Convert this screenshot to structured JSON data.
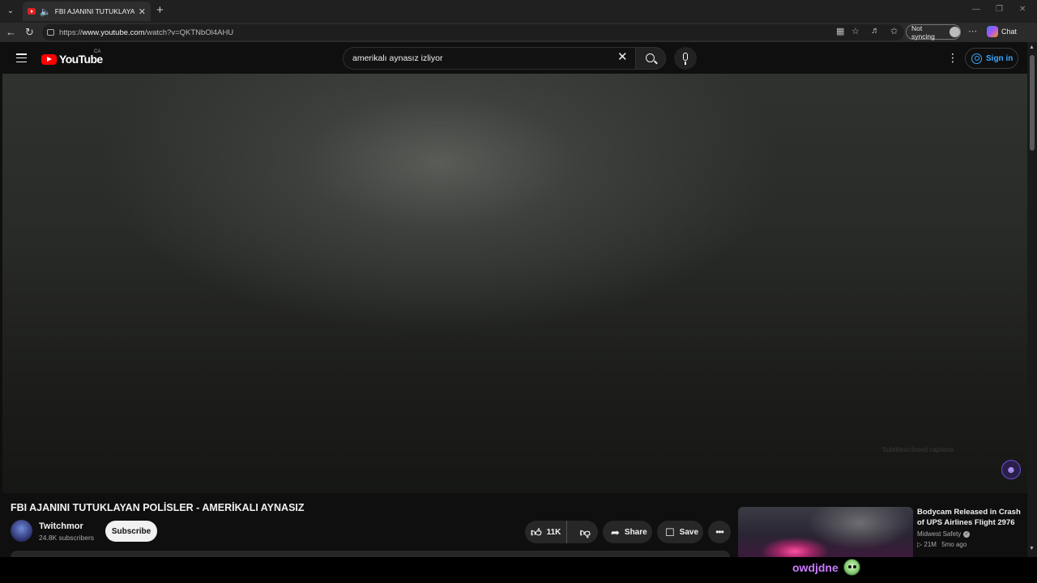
{
  "browser": {
    "tab_title": "FBI AJANINI TUTUKLAYAN POLİSLER - AMERİKALI AYNASIZ",
    "url_prefix": "https://",
    "url_host": "www.youtube.com",
    "url_path": "/watch?v=QKTNbOl4AHU",
    "sync_label": "Not syncing",
    "copilot_label": "Chat",
    "icons": [
      "tab-list-icon",
      "speaker-icon",
      "close-icon",
      "plus-icon",
      "back-icon",
      "reload-icon",
      "lock-icon",
      "app-icon",
      "star-icon",
      "reading-list-icon",
      "favorites-icon",
      "more-icon",
      "copilot-icon"
    ]
  },
  "youtube_header": {
    "logo_text": "YouTube",
    "country_code": "CA",
    "search_query": "amerikalı aynasız izliyor",
    "sign_in_label": "Sign in"
  },
  "player": {
    "captions_hint": "Subtitles/closed captions"
  },
  "video": {
    "title": "FBI AJANINI TUTUKLAYAN POLİSLER - AMERİKALI AYNASIZ",
    "channel_name": "Twitchmor",
    "subscribers": "24.8K subscribers",
    "subscribe_label": "Subscribe",
    "like_count": "11K",
    "share_label": "Share",
    "save_label": "Save"
  },
  "recommendation": {
    "title": "Bodycam Released in Crash of UPS Airlines Flight 2976",
    "channel": "Midwest Safety",
    "views": "21M",
    "age": "5mo ago"
  },
  "overlay": {
    "username": "owdjdne"
  },
  "colors": {
    "background": "#0f0f0f",
    "accent_blue": "#3ea6ff",
    "youtube_red": "#ff0000",
    "overlay_purple": "#c97bff"
  }
}
